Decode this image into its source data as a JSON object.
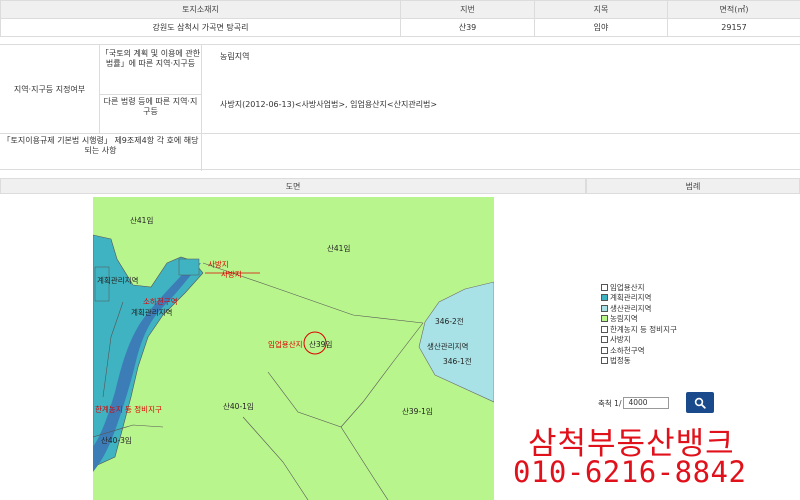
{
  "info": {
    "headers": [
      "토지소재지",
      "지번",
      "지목",
      "면적(㎡)"
    ],
    "location": "강원도 삼척시 가곡면 탕곡리",
    "lot_number": "산39",
    "land_category": "임야",
    "area": "29157"
  },
  "zoning": {
    "label": "지역·지구등 지정여부",
    "national_law_label": "「국토의 계획 및 이용에 관한 법률」에 따른 지역·지구등",
    "national_law_value": "농림지역",
    "other_law_label": "다른 법령 등에 따른 지역·지구등",
    "other_law_value": "사방지(2012-06-13)<사방사업법>, 임업용산지<산지관리법>",
    "decree_label": "「토지이용규제 기본법 시행령」 제9조제4항 각 호에 해당되는 사항"
  },
  "sections": {
    "map": "도면",
    "legend": "범례"
  },
  "legend_items": [
    {
      "label": "임업용산지",
      "color": "#ffffff"
    },
    {
      "label": "계획관리지역",
      "color": "#3fb3c1"
    },
    {
      "label": "생산관리지역",
      "color": "#a8e2e6"
    },
    {
      "label": "농림지역",
      "color": "#b9f58d"
    },
    {
      "label": "한계농지 등 정비지구",
      "color": "#ffffff"
    },
    {
      "label": "사방지",
      "color": "#ffffff"
    },
    {
      "label": "소하천구역",
      "color": "#ffffff"
    },
    {
      "label": "법정동",
      "color": "#ffffff"
    }
  ],
  "scale": {
    "label": "축척 1/",
    "value": "4000"
  },
  "map_labels": {
    "parcel_san41_a": "산41임",
    "parcel_san41_b": "산41임",
    "parcel_san39": "산39임",
    "parcel_san40_1": "산40-1임",
    "parcel_san39_1": "산39-1임",
    "parcel_san40_3": "산40-3임",
    "parcel_346_2": "346-2전",
    "parcel_346_1": "346-1전",
    "zone_planned": "계획관리지역",
    "zone_planned_2": "계획관리지역",
    "zone_production": "생산관리지역",
    "zone_forestry_use": "임업용산지",
    "zone_erosion_1": "사방지",
    "zone_erosion_2": "사방지",
    "zone_small_stream": "소하천구역",
    "zone_limit_farm": "한계농지 등 정비지구"
  },
  "advert": {
    "name": "삼척부동산뱅크",
    "phone": "010-6216-8842"
  },
  "colors": {
    "farm_forest_green": "#b9f58d",
    "planned_teal": "#3fb3c1",
    "production_light": "#a8e2e6",
    "river_blue": "#3c7db8",
    "advert_red": "#e0111b"
  }
}
